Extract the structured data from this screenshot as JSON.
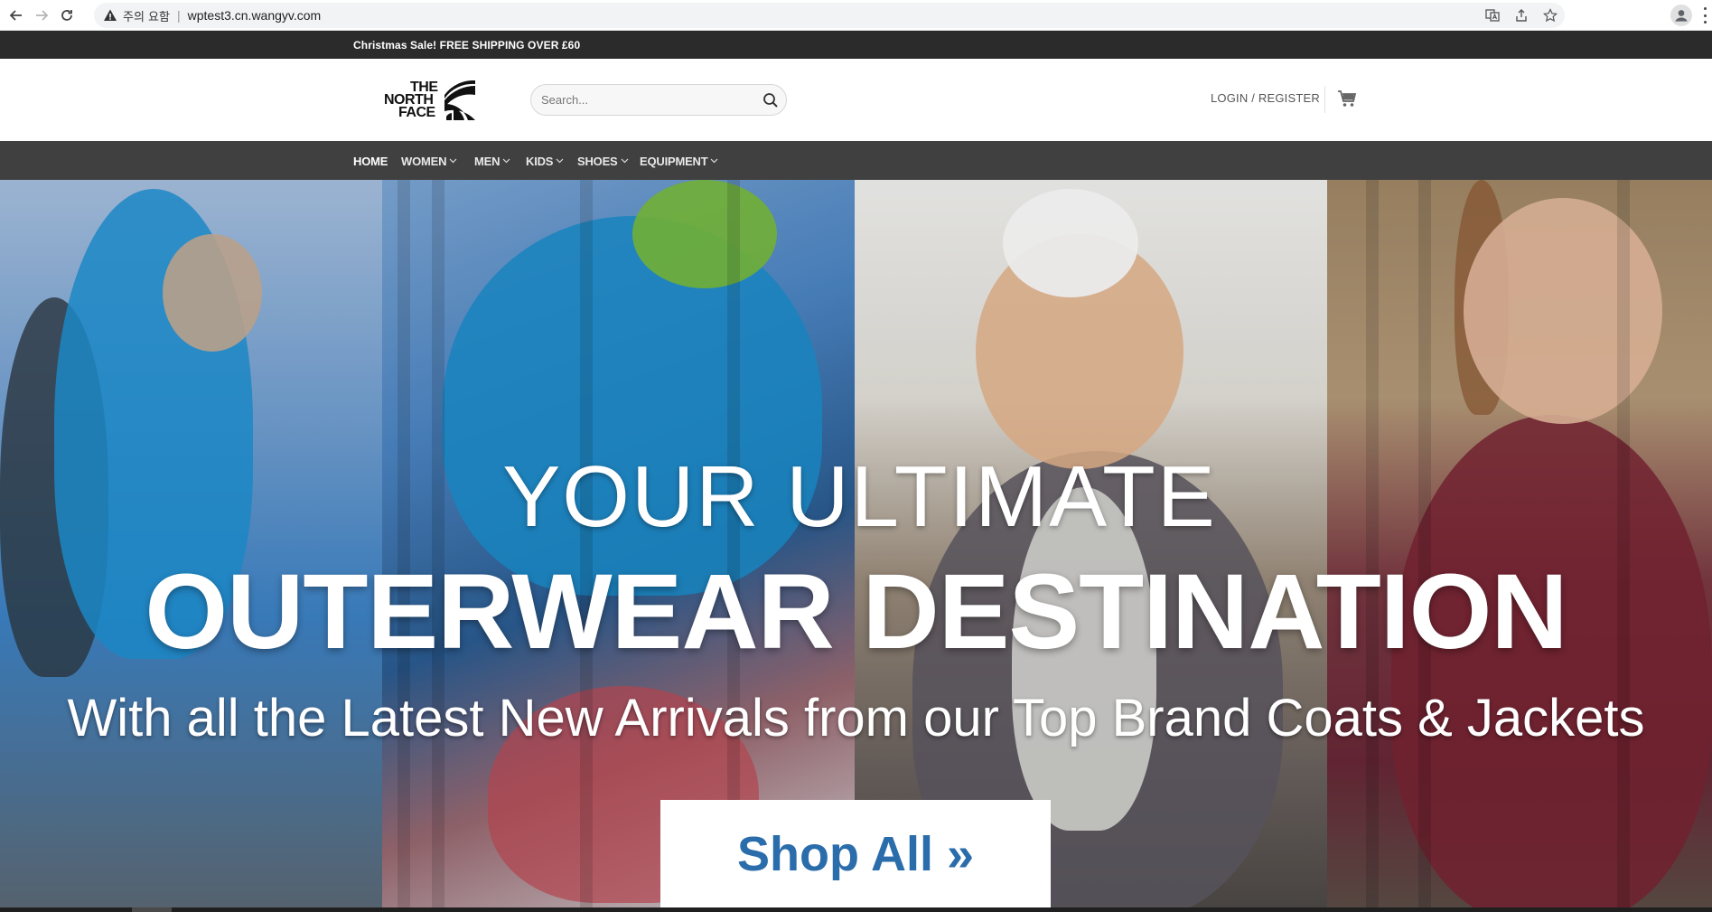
{
  "browser": {
    "security_label": "주의 요함",
    "url": "wptest3.cn.wangyv.com"
  },
  "promo": {
    "text": "Christmas Sale! FREE SHIPPING OVER £60"
  },
  "header": {
    "logo": {
      "line1": "THE",
      "line2": "NORTH",
      "line3": "FACE"
    },
    "search": {
      "placeholder": "Search..."
    },
    "login_label": "LOGIN / REGISTER"
  },
  "nav": {
    "items": [
      {
        "label": "HOME",
        "dropdown": false,
        "active": true
      },
      {
        "label": "WOMEN",
        "dropdown": true
      },
      {
        "label": "MEN",
        "dropdown": true
      },
      {
        "label": "KIDS",
        "dropdown": true
      },
      {
        "label": "SHOES",
        "dropdown": true
      },
      {
        "label": "EQUIPMENT",
        "dropdown": true
      }
    ]
  },
  "hero": {
    "line1": "YOUR ULTIMATE",
    "line2": "OUTERWEAR DESTINATION",
    "line3": "With all the Latest New Arrivals from our Top Brand Coats & Jackets",
    "cta_label": "Shop All »"
  },
  "colors": {
    "promo_bg": "#2b2b2b",
    "nav_bg": "#404040",
    "cta_text": "#2b6dab"
  }
}
